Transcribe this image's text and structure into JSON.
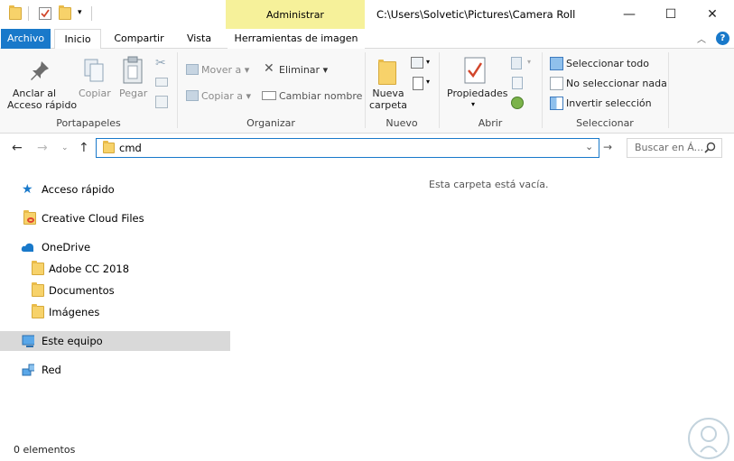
{
  "window": {
    "title_path": "C:\\Users\\Solvetic\\Pictures\\Camera Roll",
    "context_tab": "Administrar",
    "minimize": "—",
    "maximize": "☐",
    "close": "✕"
  },
  "tabs": [
    {
      "label": "Archivo"
    },
    {
      "label": "Inicio"
    },
    {
      "label": "Compartir"
    },
    {
      "label": "Vista"
    },
    {
      "label": "Herramientas de imagen"
    }
  ],
  "ribbon": {
    "portapapeles": {
      "pin_label_1": "Anclar al",
      "pin_label_2": "Acceso rápido",
      "copy": "Copiar",
      "paste": "Pegar",
      "group": "Portapapeles"
    },
    "organizar": {
      "move_to": "Mover a",
      "copy_to": "Copiar a",
      "delete": "Eliminar",
      "rename": "Cambiar nombre",
      "group": "Organizar"
    },
    "nuevo": {
      "new_folder_1": "Nueva",
      "new_folder_2": "carpeta",
      "group": "Nuevo"
    },
    "abrir": {
      "properties": "Propiedades",
      "group": "Abrir"
    },
    "seleccionar": {
      "select_all": "Seleccionar todo",
      "select_none": "No seleccionar nada",
      "invert": "Invertir selección",
      "group": "Seleccionar"
    }
  },
  "address": {
    "path": "cmd",
    "search_placeholder": "Buscar en Á..."
  },
  "nav": [
    {
      "label": "Acceso rápido"
    },
    {
      "label": "Creative Cloud Files"
    },
    {
      "label": "OneDrive"
    },
    {
      "label": "Adobe CC 2018"
    },
    {
      "label": "Documentos"
    },
    {
      "label": "Imágenes"
    },
    {
      "label": "Este equipo"
    },
    {
      "label": "Red"
    }
  ],
  "content": {
    "empty_message": "Esta carpeta está vacía."
  },
  "status": {
    "items": "0 elementos"
  },
  "colors": {
    "accent": "#1979ca",
    "context_tab": "#f6f19a",
    "selected_nav": "#d9d9d9"
  }
}
